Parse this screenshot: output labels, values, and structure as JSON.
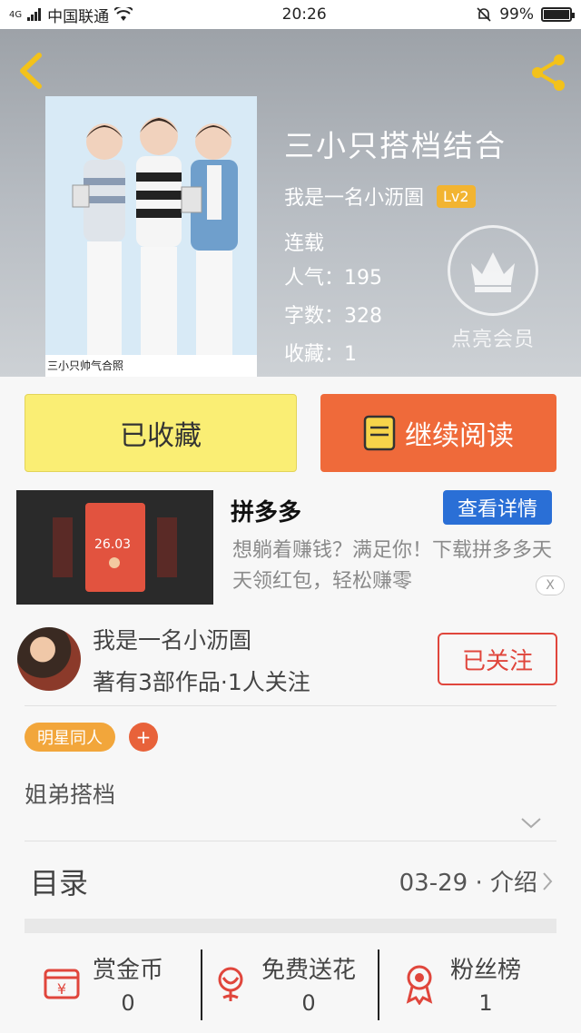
{
  "status_bar": {
    "network": "4G",
    "carrier": "中国联通",
    "time": "20:26",
    "battery": "99%",
    "battery_level": 0.99
  },
  "header": {
    "back_icon": "back-chevron-icon",
    "share_icon": "share-icon"
  },
  "book": {
    "cover_caption": "三小只帅气合照",
    "title": "三小只搭档结合",
    "author": "我是一名小沥圄",
    "level": "Lv2",
    "status": "连载",
    "popularity": "人气：195",
    "word_count": "字数：328",
    "favorites": "收藏：1",
    "vip_label": "点亮会员"
  },
  "actions": {
    "collected": "已收藏",
    "continue": "继续阅读"
  },
  "ad": {
    "title": "拼多多",
    "detail_button": "查看详情",
    "description": "想躺着赚钱？满足你！下载拼多多天天领红包，轻松赚零",
    "thumb_amount": "26.03",
    "close_label": "X"
  },
  "author_card": {
    "name": "我是一名小沥圄",
    "stats": "著有3部作品·1人关注",
    "follow_label": "已关注"
  },
  "tags": {
    "tag": "明星同人",
    "add": "+"
  },
  "summary": "姐弟搭档",
  "toc": {
    "label": "目录",
    "info": "03-29 · 介绍"
  },
  "bottom_bar": [
    {
      "label": "赏金币",
      "value": "0",
      "icon": "reward-coin-icon"
    },
    {
      "label": "免费送花",
      "value": "0",
      "icon": "flower-icon"
    },
    {
      "label": "粉丝榜",
      "value": "1",
      "icon": "medal-icon"
    }
  ],
  "colors": {
    "accent_orange": "#ef6a3a",
    "collected_yellow": "#faee74",
    "follow_red": "#e0463c",
    "detail_blue": "#2a6fd6",
    "tag_orange": "#f2a63b"
  }
}
